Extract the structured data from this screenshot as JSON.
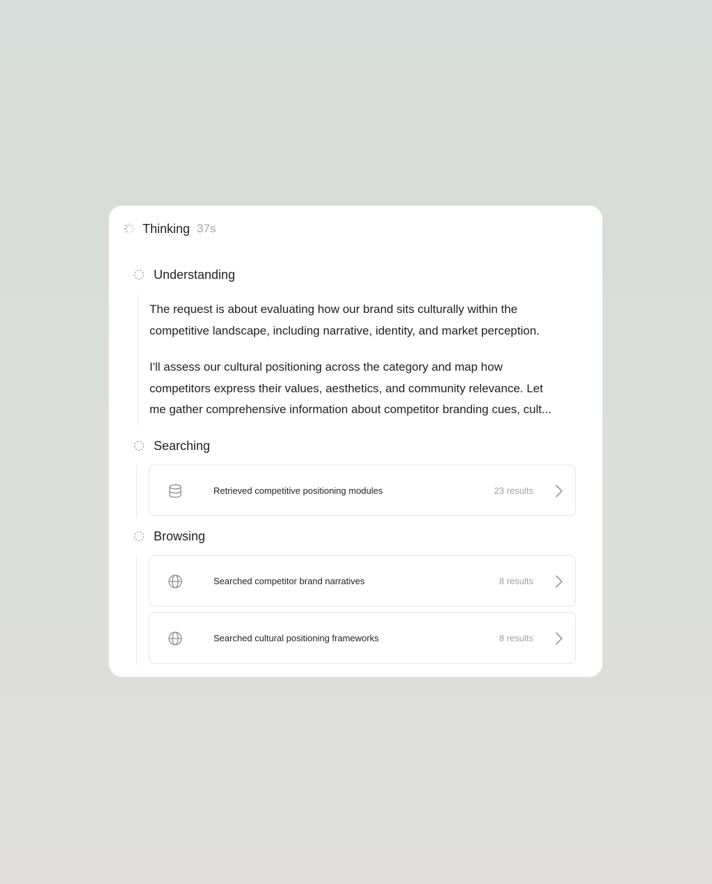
{
  "thinking": {
    "label": "Thinking",
    "elapsed": "37s",
    "icon": "spinner-icon"
  },
  "steps": [
    {
      "title": "Understanding",
      "icon": "pending-step-icon",
      "paragraphs": [
        {
          "lines": [
            "The request is about evaluating how our brand sits culturally within the",
            "competitive landscape, including narrative, identity, and market perception."
          ]
        },
        {
          "lines": [
            "I'll assess our cultural positioning across the category and map how",
            "competitors express their values, aesthetics, and community relevance. Let",
            "me gather comprehensive information about competitor branding cues, cult..."
          ]
        }
      ]
    },
    {
      "title": "Searching",
      "icon": "pending-step-icon",
      "results": [
        {
          "icon": "database-icon",
          "label": "Retrieved competitive positioning modules",
          "count": "23 results"
        }
      ]
    },
    {
      "title": "Browsing",
      "icon": "pending-step-icon",
      "results": [
        {
          "icon": "globe-icon",
          "label": "Searched competitor brand narratives",
          "count": "8 results"
        },
        {
          "icon": "globe-icon",
          "label": "Searched cultural positioning frameworks",
          "count": "8 results"
        }
      ]
    }
  ],
  "colors": {
    "text": "#1e1e1e",
    "muted": "#a0a0a0",
    "border": "#e6e6e3",
    "icon": "#8a8a8a"
  }
}
